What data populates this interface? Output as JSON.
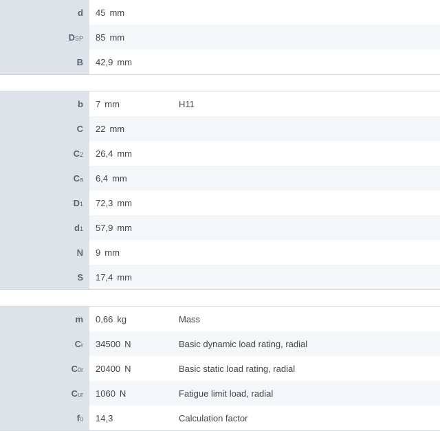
{
  "groups": [
    {
      "rows": [
        {
          "sym": "d",
          "sub": "",
          "value": "45",
          "unit": "mm",
          "desc": ""
        },
        {
          "sym": "D",
          "sub": "SP",
          "value": "85",
          "unit": "mm",
          "desc": ""
        },
        {
          "sym": "B",
          "sub": "",
          "value": "42,9",
          "unit": "mm",
          "desc": ""
        }
      ]
    },
    {
      "rows": [
        {
          "sym": "b",
          "sub": "",
          "value": "7",
          "unit": "mm",
          "desc": "H11"
        },
        {
          "sym": "C",
          "sub": "",
          "value": "22",
          "unit": "mm",
          "desc": ""
        },
        {
          "sym": "C",
          "sub": "2",
          "value": "26,4",
          "unit": "mm",
          "desc": ""
        },
        {
          "sym": "C",
          "sub": "a",
          "value": "6,4",
          "unit": "mm",
          "desc": ""
        },
        {
          "sym": "D",
          "sub": "1",
          "value": "72,3",
          "unit": "mm",
          "desc": ""
        },
        {
          "sym": "d",
          "sub": "1",
          "value": "57,9",
          "unit": "mm",
          "desc": ""
        },
        {
          "sym": "N",
          "sub": "",
          "value": "9",
          "unit": "mm",
          "desc": ""
        },
        {
          "sym": "S",
          "sub": "",
          "value": "17,4",
          "unit": "mm",
          "desc": ""
        }
      ]
    },
    {
      "rows": [
        {
          "sym": "m",
          "sub": "",
          "value": "0,66",
          "unit": "kg",
          "desc": "Mass"
        },
        {
          "sym": "C",
          "sub": "r",
          "value": "34500",
          "unit": "N",
          "desc": "Basic dynamic load rating, radial"
        },
        {
          "sym": "C",
          "sub": "0r",
          "value": "20400",
          "unit": "N",
          "desc": "Basic static load rating, radial"
        },
        {
          "sym": "C",
          "sub": "ur",
          "value": "1060",
          "unit": "N",
          "desc": "Fatigue limit load, radial"
        },
        {
          "sym": "f",
          "sub": "0",
          "value": "14,3",
          "unit": "",
          "desc": "Calculation factor"
        }
      ]
    }
  ],
  "colors": {
    "symbol_column_bg": "#dde3e9",
    "alt_row_bg": "#f4f7fa",
    "divider": "#d3d9df"
  }
}
